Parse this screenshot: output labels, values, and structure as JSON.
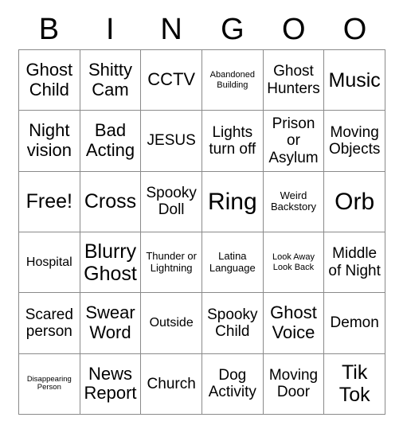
{
  "card": {
    "title_letters": [
      "B",
      "I",
      "N",
      "G",
      "O",
      "O"
    ],
    "columns": 6,
    "rows": 6,
    "border_color": "#8a8a8a",
    "text_color": "#000000",
    "background_color": "#ffffff",
    "cells": [
      [
        {
          "text": "Ghost Child",
          "size": "l"
        },
        {
          "text": "Shitty Cam",
          "size": "l"
        },
        {
          "text": "CCTV",
          "size": "l"
        },
        {
          "text": "Abandoned Building",
          "size": "xxs"
        },
        {
          "text": "Ghost Hunters",
          "size": "m"
        },
        {
          "text": "Music",
          "size": "xl"
        }
      ],
      [
        {
          "text": "Night vision",
          "size": "l"
        },
        {
          "text": "Bad Acting",
          "size": "l"
        },
        {
          "text": "JESUS",
          "size": "m"
        },
        {
          "text": "Lights turn off",
          "size": "m"
        },
        {
          "text": "Prison or Asylum",
          "size": "m"
        },
        {
          "text": "Moving Objects",
          "size": "m"
        }
      ],
      [
        {
          "text": "Free!",
          "size": "xl"
        },
        {
          "text": "Cross",
          "size": "xl"
        },
        {
          "text": "Spooky Doll",
          "size": "m"
        },
        {
          "text": "Ring",
          "size": "xxl"
        },
        {
          "text": "Weird Backstory",
          "size": "xs"
        },
        {
          "text": "Orb",
          "size": "xxl"
        }
      ],
      [
        {
          "text": "Hospital",
          "size": "s"
        },
        {
          "text": "Blurry Ghost",
          "size": "xl"
        },
        {
          "text": "Thunder or Lightning",
          "size": "xs"
        },
        {
          "text": "Latina Language",
          "size": "xs"
        },
        {
          "text": "Look Away Look Back",
          "size": "xxs"
        },
        {
          "text": "Middle of Night",
          "size": "m"
        }
      ],
      [
        {
          "text": "Scared person",
          "size": "m"
        },
        {
          "text": "Swear Word",
          "size": "l"
        },
        {
          "text": "Outside",
          "size": "s"
        },
        {
          "text": "Spooky Child",
          "size": "m"
        },
        {
          "text": "Ghost Voice",
          "size": "l"
        },
        {
          "text": "Demon",
          "size": "m"
        }
      ],
      [
        {
          "text": "Disappearing Person",
          "size": "tiny"
        },
        {
          "text": "News Report",
          "size": "l"
        },
        {
          "text": "Church",
          "size": "m"
        },
        {
          "text": "Dog Activity",
          "size": "m"
        },
        {
          "text": "Moving Door",
          "size": "m"
        },
        {
          "text": "Tik Tok",
          "size": "xl"
        }
      ]
    ]
  }
}
